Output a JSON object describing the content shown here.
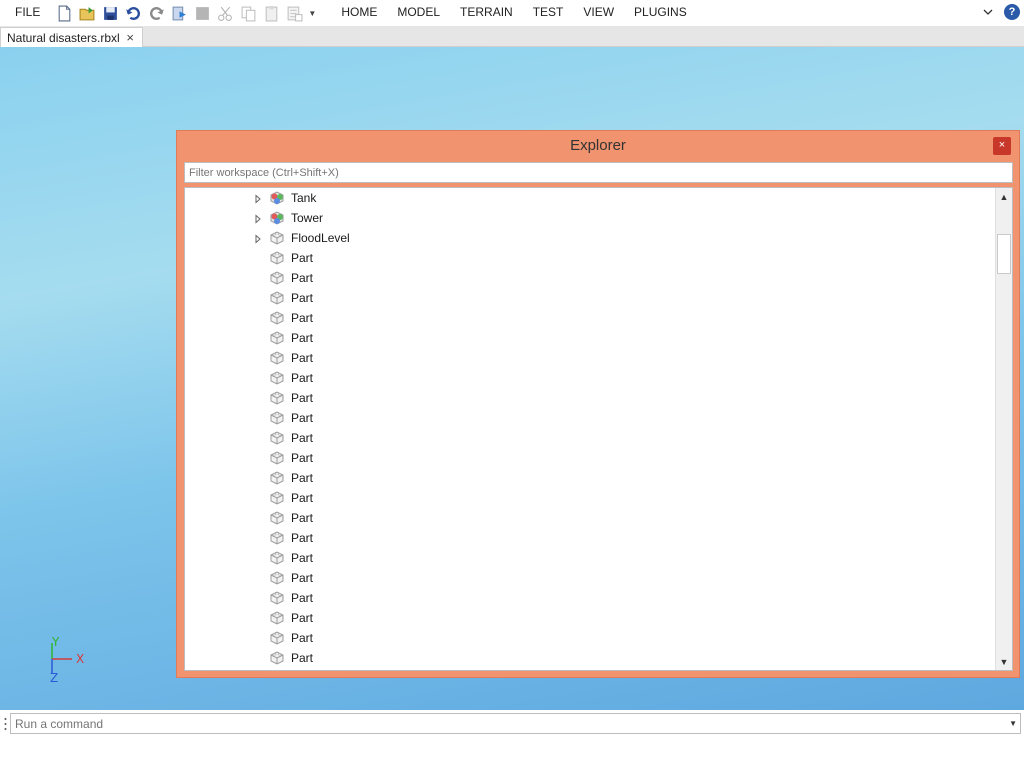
{
  "menubar": {
    "file_label": "FILE",
    "tabs": [
      "HOME",
      "MODEL",
      "TERRAIN",
      "TEST",
      "VIEW",
      "PLUGINS"
    ],
    "quick_access": [
      "new-file-icon",
      "open-folder-icon",
      "save-icon",
      "undo-icon",
      "redo-icon",
      "publish-icon",
      "stop-icon",
      "cut-icon",
      "copy-icon",
      "paste-icon",
      "duplicate-icon"
    ],
    "help_label": "?"
  },
  "document_tab": {
    "title": "Natural disasters.rbxl",
    "close": "×"
  },
  "axes": {
    "x": "X",
    "y": "Y",
    "z": "Z"
  },
  "explorer": {
    "title": "Explorer",
    "close": "×",
    "filter_placeholder": "Filter workspace (Ctrl+Shift+X)",
    "items": [
      {
        "label": "Tank",
        "icon": "model-icon",
        "expandable": true
      },
      {
        "label": "Tower",
        "icon": "model-icon",
        "expandable": true
      },
      {
        "label": "FloodLevel",
        "icon": "part-icon",
        "expandable": true
      },
      {
        "label": "Part",
        "icon": "part-icon",
        "expandable": false
      },
      {
        "label": "Part",
        "icon": "part-icon",
        "expandable": false
      },
      {
        "label": "Part",
        "icon": "part-icon",
        "expandable": false
      },
      {
        "label": "Part",
        "icon": "part-icon",
        "expandable": false
      },
      {
        "label": "Part",
        "icon": "part-icon",
        "expandable": false
      },
      {
        "label": "Part",
        "icon": "part-icon",
        "expandable": false
      },
      {
        "label": "Part",
        "icon": "part-icon",
        "expandable": false
      },
      {
        "label": "Part",
        "icon": "part-icon",
        "expandable": false
      },
      {
        "label": "Part",
        "icon": "part-icon",
        "expandable": false
      },
      {
        "label": "Part",
        "icon": "part-icon",
        "expandable": false
      },
      {
        "label": "Part",
        "icon": "part-icon",
        "expandable": false
      },
      {
        "label": "Part",
        "icon": "part-icon",
        "expandable": false
      },
      {
        "label": "Part",
        "icon": "part-icon",
        "expandable": false
      },
      {
        "label": "Part",
        "icon": "part-icon",
        "expandable": false
      },
      {
        "label": "Part",
        "icon": "part-icon",
        "expandable": false
      },
      {
        "label": "Part",
        "icon": "part-icon",
        "expandable": false
      },
      {
        "label": "Part",
        "icon": "part-icon",
        "expandable": false
      },
      {
        "label": "Part",
        "icon": "part-icon",
        "expandable": false
      },
      {
        "label": "Part",
        "icon": "part-icon",
        "expandable": false
      },
      {
        "label": "Part",
        "icon": "part-icon",
        "expandable": false
      },
      {
        "label": "Part",
        "icon": "part-icon",
        "expandable": false
      },
      {
        "label": "Part",
        "icon": "part-icon",
        "expandable": false
      },
      {
        "label": "Part",
        "icon": "part-icon",
        "expandable": false
      }
    ]
  },
  "command_bar": {
    "placeholder": "Run a command"
  },
  "colors": {
    "explorer_frame": "#f0936e",
    "close_button": "#c8382a",
    "viewport_sky": "#8ad1ef"
  }
}
